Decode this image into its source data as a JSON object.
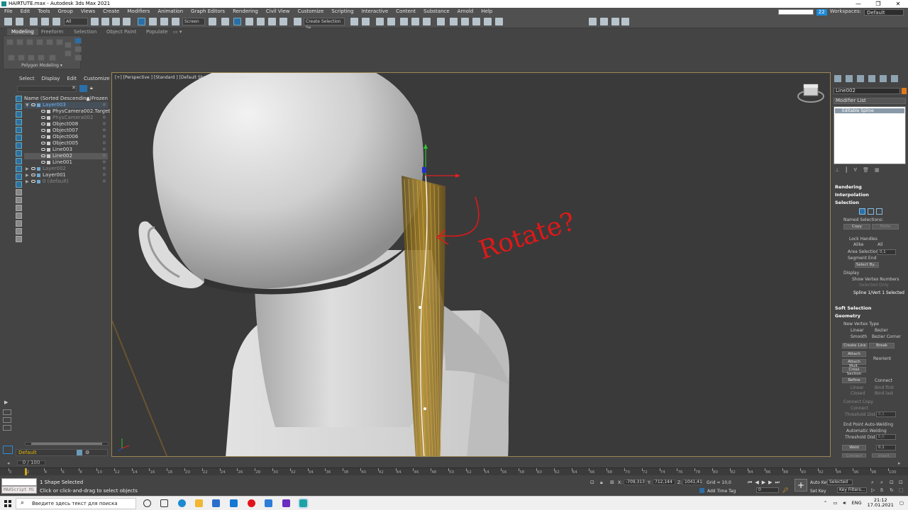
{
  "window": {
    "title": "HAIRTUTE.max - Autodesk 3ds Max 2021",
    "controls": [
      "—",
      "❐",
      "✕"
    ]
  },
  "menu": {
    "items": [
      "File",
      "Edit",
      "Tools",
      "Group",
      "Views",
      "Create",
      "Modifiers",
      "Animation",
      "Graph Editors",
      "Rendering",
      "Civil View",
      "Customize",
      "Scripting",
      "Interactive",
      "Content",
      "Substance",
      "Arnold",
      "Help"
    ],
    "badge": "22",
    "workspaces_label": "Workspaces:",
    "workspace_value": "Default"
  },
  "toolbar": {
    "selection_filter": "All",
    "ref_coord": "Screen",
    "named_selection": "Create Selection Se"
  },
  "ribbon": {
    "tabs": [
      "Modeling",
      "Freeform",
      "Selection",
      "Object Paint",
      "Populate"
    ],
    "panel_label": "Polygon Modeling ▾"
  },
  "scene_explorer": {
    "tabs": [
      "Select",
      "Display",
      "Edit",
      "Customize"
    ],
    "header": {
      "name": "Name (Sorted Descending)",
      "frozen": "▲ Frozen"
    },
    "rows": [
      {
        "label": "Layer003",
        "indent": 0,
        "type": "layer",
        "state": "active"
      },
      {
        "label": "PhysCamera002.Target",
        "indent": 1,
        "type": "obj",
        "state": ""
      },
      {
        "label": "PhysCamera002",
        "indent": 1,
        "type": "obj",
        "state": "dim"
      },
      {
        "label": "Object008",
        "indent": 1,
        "type": "obj",
        "state": ""
      },
      {
        "label": "Object007",
        "indent": 1,
        "type": "obj",
        "state": ""
      },
      {
        "label": "Object006",
        "indent": 1,
        "type": "obj",
        "state": ""
      },
      {
        "label": "Object005",
        "indent": 1,
        "type": "obj",
        "state": ""
      },
      {
        "label": "Line003",
        "indent": 1,
        "type": "obj",
        "state": ""
      },
      {
        "label": "Line002",
        "indent": 1,
        "type": "obj",
        "state": "sel"
      },
      {
        "label": "Line001",
        "indent": 1,
        "type": "obj",
        "state": ""
      },
      {
        "label": "Layer002",
        "indent": 0,
        "type": "layer",
        "state": "dim"
      },
      {
        "label": "Layer001",
        "indent": 0,
        "type": "layer",
        "state": ""
      },
      {
        "label": "0 (default)",
        "indent": 0,
        "type": "layer",
        "state": "dim"
      }
    ],
    "layer_field": "Default"
  },
  "viewport": {
    "label": "[+] [Perspective ] [Standard ] [Default Shading ] <<Disabled>>",
    "annotation": "Rotate?"
  },
  "command_panel": {
    "object_name": "Line002",
    "modifier_list": "Modifier List",
    "stack_item": "Editable Spline",
    "rollouts": {
      "rendering": "Rendering",
      "interpolation": "Interpolation",
      "selection": "Selection",
      "soft_selection": "Soft Selection",
      "geometry": "Geometry"
    },
    "selection": {
      "named_selections": "Named Selections:",
      "copy": "Copy",
      "paste": "Paste",
      "lock_handles": "Lock Handles",
      "alike": "Alike",
      "all": "All",
      "area_selection": "Area Selection:",
      "area_value": "0,1",
      "segment_end": "Segment End",
      "select_by": "Select By...",
      "display": "Display",
      "show_vertex_numbers": "Show Vertex Numbers",
      "selected_only": "Selected Only",
      "status": "Spline 1/Vert 1 Selected"
    },
    "geometry": {
      "new_vertex_type": "New Vertex Type",
      "linear": "Linear",
      "bezier": "Bezier",
      "smooth": "Smooth",
      "bezier_corner": "Bezier Corner",
      "create_line": "Create Line",
      "break": "Break",
      "attach": "Attach",
      "attach_mult": "Attach Mult.",
      "reorient": "Reorient",
      "cross_section": "Cross Section",
      "refine": "Refine",
      "connect": "Connect",
      "linear2": "Linear",
      "bind_first": "Bind first",
      "closed": "Closed",
      "bind_last": "Bind last",
      "connect_copy": "Connect Copy",
      "connect2": "Connect",
      "threshold_dist": "Threshold Dist",
      "threshold_value": "0,1",
      "end_point_auto_welding": "End Point Auto-Welding",
      "automatic_welding": "Automatic Welding",
      "threshold_dist2": "Threshold Dist",
      "threshold_value2": "6,0",
      "weld": "Weld",
      "weld_value": "0,1",
      "connect3": "Connect",
      "insert": "Insert"
    }
  },
  "timeline": {
    "frame_counter": "0 / 100",
    "ticks": [
      0,
      2,
      4,
      6,
      8,
      10,
      12,
      14,
      16,
      18,
      20,
      22,
      24,
      26,
      28,
      30,
      32,
      34,
      36,
      38,
      40,
      42,
      44,
      46,
      48,
      50,
      52,
      54,
      56,
      58,
      60,
      62,
      64,
      66,
      68,
      70,
      72,
      74,
      76,
      78,
      80,
      82,
      84,
      86,
      88,
      90,
      92,
      94,
      96,
      98,
      100
    ]
  },
  "status": {
    "selection": "1 Shape Selected",
    "prompt": "Click or click-and-drag to select objects",
    "maxscript": "MAXScript Mi",
    "x_label": "X:",
    "x": "-709,313",
    "y_label": "Y:",
    "y": "712,144",
    "z_label": "Z:",
    "z": "1041,41",
    "grid": "Grid = 10,0",
    "add_time_tag": "Add Time Tag",
    "auto_key": "Auto Key",
    "set_key": "Set Key",
    "key_mode": "Selected",
    "key_filters": "Key Filters...",
    "frame": "0"
  },
  "taskbar": {
    "search_placeholder": "Введите здесь текст для поиска",
    "lang": "ENG",
    "time": "21:12",
    "date": "17.01.2021"
  }
}
